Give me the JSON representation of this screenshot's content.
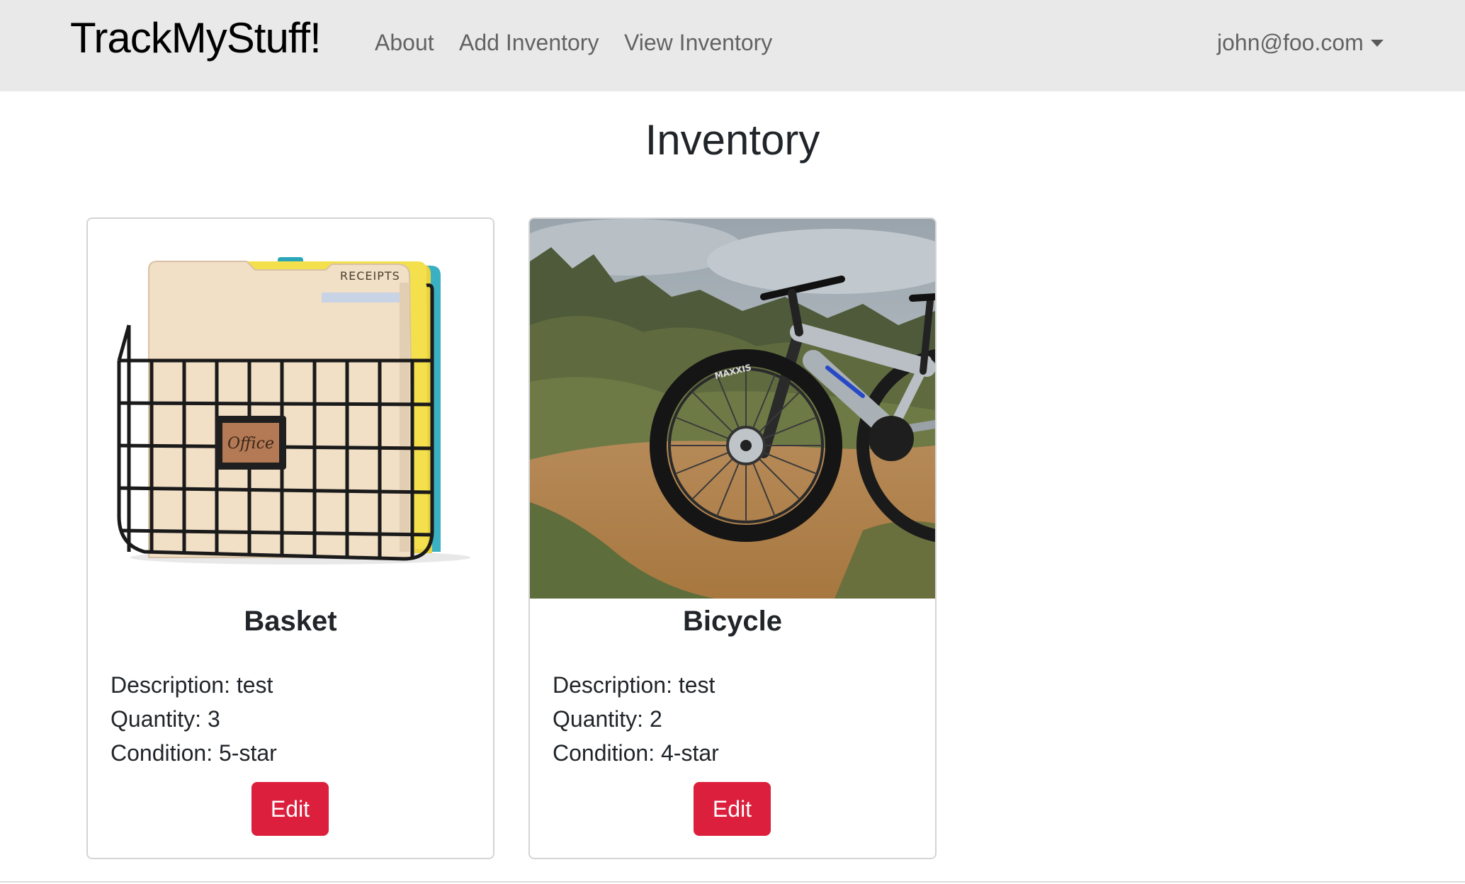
{
  "navbar": {
    "brand": "TrackMyStuff!",
    "links": [
      "About",
      "Add Inventory",
      "View Inventory"
    ],
    "user": "john@foo.com"
  },
  "page": {
    "title": "Inventory"
  },
  "items": [
    {
      "name": "Basket",
      "description": "Description: test",
      "quantity": "Quantity: 3",
      "condition": "Condition: 5-star",
      "edit_label": "Edit",
      "image": {
        "subject": "wire wall basket with file folders",
        "folder_tab": "RECEIPTS",
        "plate": "Office"
      }
    },
    {
      "name": "Bicycle",
      "description": "Description: test",
      "quantity": "Quantity: 2",
      "condition": "Condition: 4-star",
      "edit_label": "Edit",
      "image": {
        "subject": "electric mountain bike on dirt trail",
        "tire": "MAXXIS"
      }
    }
  ],
  "colors": {
    "navbar_bg": "#e9e9e9",
    "edit_button": "#dc1f3c",
    "card_border": "#d4d4d4"
  }
}
